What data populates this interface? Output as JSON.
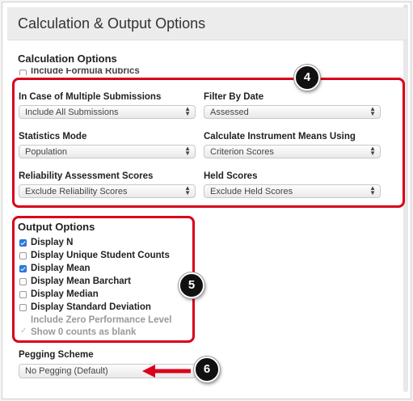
{
  "panel": {
    "title": "Calculation & Output Options"
  },
  "calculation": {
    "title": "Calculation Options",
    "clipped_row": {
      "label": "Include Formula Rubrics",
      "checked": false
    },
    "fields": [
      {
        "label": "In Case of Multiple Submissions",
        "value": "Include All Submissions"
      },
      {
        "label": "Filter By Date",
        "value": "Assessed"
      },
      {
        "label": "Statistics Mode",
        "value": "Population"
      },
      {
        "label": "Calculate Instrument Means Using",
        "value": "Criterion Scores"
      },
      {
        "label": "Reliability Assessment Scores",
        "value": "Exclude Reliability Scores"
      },
      {
        "label": "Held Scores",
        "value": "Exclude Held Scores"
      }
    ]
  },
  "output": {
    "title": "Output Options",
    "options": [
      {
        "label": "Display N",
        "checked": true,
        "enabled": true
      },
      {
        "label": "Display Unique Student Counts",
        "checked": false,
        "enabled": true
      },
      {
        "label": "Display Mean",
        "checked": true,
        "enabled": true
      },
      {
        "label": "Display Mean Barchart",
        "checked": false,
        "enabled": true
      },
      {
        "label": "Display Median",
        "checked": false,
        "enabled": true
      },
      {
        "label": "Display Standard Deviation",
        "checked": false,
        "enabled": true
      },
      {
        "label": "Include Zero Performance Level",
        "checked": false,
        "enabled": false
      },
      {
        "label": "Show 0 counts as blank",
        "checked": true,
        "enabled": false
      }
    ]
  },
  "pegging": {
    "label": "Pegging Scheme",
    "value": "No Pegging (Default)"
  },
  "annotations": {
    "callout_4": "4",
    "callout_5": "5",
    "callout_6": "6",
    "highlight_color": "#d9001b"
  },
  "icons": {
    "select_arrows": "updown-arrows-icon",
    "checkmark": "checkmark-icon"
  },
  "colors": {
    "accent": "#2d7be0",
    "header_bg": "#ececec"
  }
}
